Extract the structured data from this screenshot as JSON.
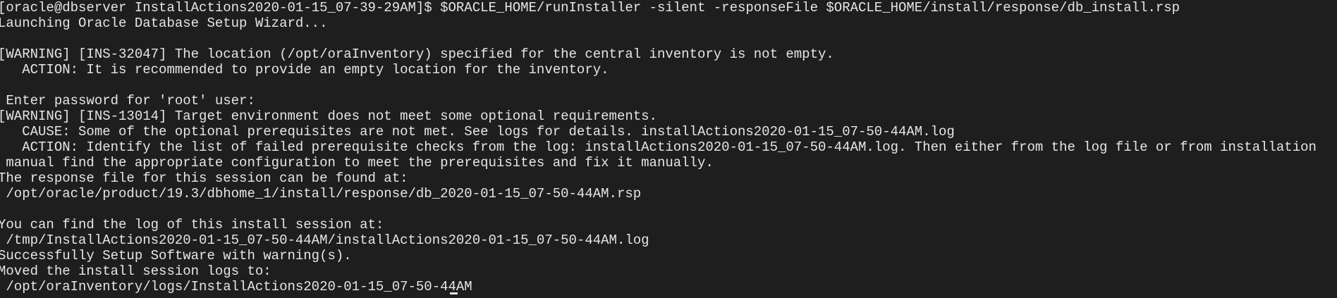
{
  "terminal": {
    "lines": [
      "[oracle@dbserver InstallActions2020-01-15_07-39-29AM]$ $ORACLE_HOME/runInstaller -silent -responseFile $ORACLE_HOME/install/response/db_install.rsp",
      "Launching Oracle Database Setup Wizard...",
      "",
      "[WARNING] [INS-32047] The location (/opt/oraInventory) specified for the central inventory is not empty.",
      "   ACTION: It is recommended to provide an empty location for the inventory.",
      "",
      " Enter password for 'root' user:",
      "[WARNING] [INS-13014] Target environment does not meet some optional requirements.",
      "   CAUSE: Some of the optional prerequisites are not met. See logs for details. installActions2020-01-15_07-50-44AM.log",
      "   ACTION: Identify the list of failed prerequisite checks from the log: installActions2020-01-15_07-50-44AM.log. Then either from the log file or from installation",
      " manual find the appropriate configuration to meet the prerequisites and fix it manually.",
      "The response file for this session can be found at:",
      " /opt/oracle/product/19.3/dbhome_1/install/response/db_2020-01-15_07-50-44AM.rsp",
      "",
      "You can find the log of this install session at:",
      " /tmp/InstallActions2020-01-15_07-50-44AM/installActions2020-01-15_07-50-44AM.log",
      "Successfully Setup Software with warning(s).",
      "Moved the install session logs to:",
      " /opt/oraInventory/logs/InstallActions2020-01-15_07-50-44AM"
    ]
  }
}
